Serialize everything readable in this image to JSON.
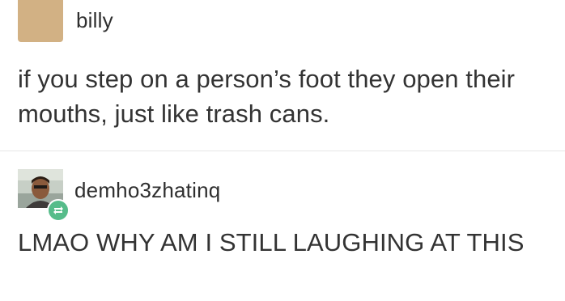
{
  "posts": [
    {
      "username": "billy",
      "text": "if you step on a person’s foot they open their mouths, just like trash cans.",
      "avatar": {
        "type": "solid",
        "color": "#d2b184"
      }
    },
    {
      "username": "demho3zhatinq",
      "text": "LMAO WHY AM I STILL LAUGHING AT THIS",
      "avatar": {
        "type": "photo"
      },
      "badge": {
        "icon": "reblog-icon",
        "color": "#56bc8a"
      }
    }
  ]
}
